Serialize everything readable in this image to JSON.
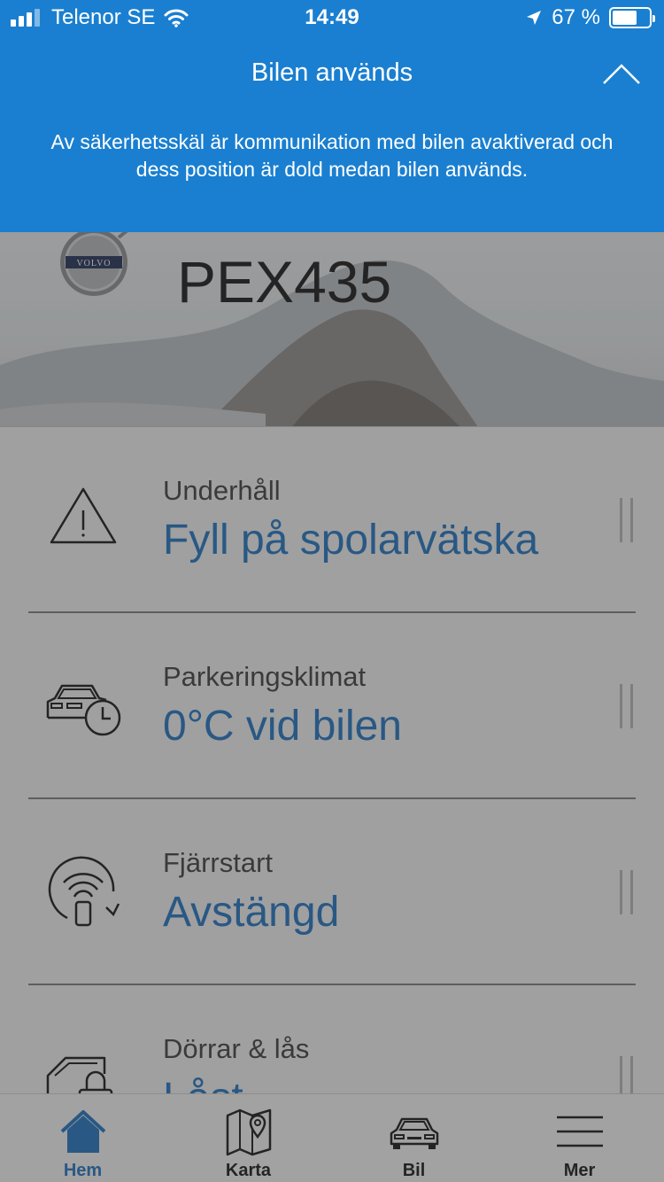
{
  "status_bar": {
    "carrier": "Telenor SE",
    "time": "14:49",
    "battery": "67 %",
    "battery_level": 0.67
  },
  "banner": {
    "title": "Bilen används",
    "message": "Av säkerhetsskäl är kommunikation med bilen avaktiverad och dess position är dold medan bilen används."
  },
  "hero": {
    "brand_logo": "VOLVO",
    "registration": "PEX435"
  },
  "list": [
    {
      "icon": "warning-icon",
      "label": "Underhåll",
      "value": "Fyll på spolarvätska"
    },
    {
      "icon": "car-clock-icon",
      "label": "Parkeringsklimat",
      "value": "0°C vid bilen"
    },
    {
      "icon": "remote-start-icon",
      "label": "Fjärrstart",
      "value": "Avstängd"
    },
    {
      "icon": "car-lock-icon",
      "label": "Dörrar & lås",
      "value": "Låst"
    }
  ],
  "tabs": [
    {
      "icon": "home-icon",
      "label": "Hem",
      "active": true
    },
    {
      "icon": "map-icon",
      "label": "Karta",
      "active": false
    },
    {
      "icon": "car-icon",
      "label": "Bil",
      "active": false
    },
    {
      "icon": "menu-icon",
      "label": "Mer",
      "active": false
    }
  ],
  "colors": {
    "banner": "#1a7fd0",
    "accent": "#1a6fbf"
  }
}
